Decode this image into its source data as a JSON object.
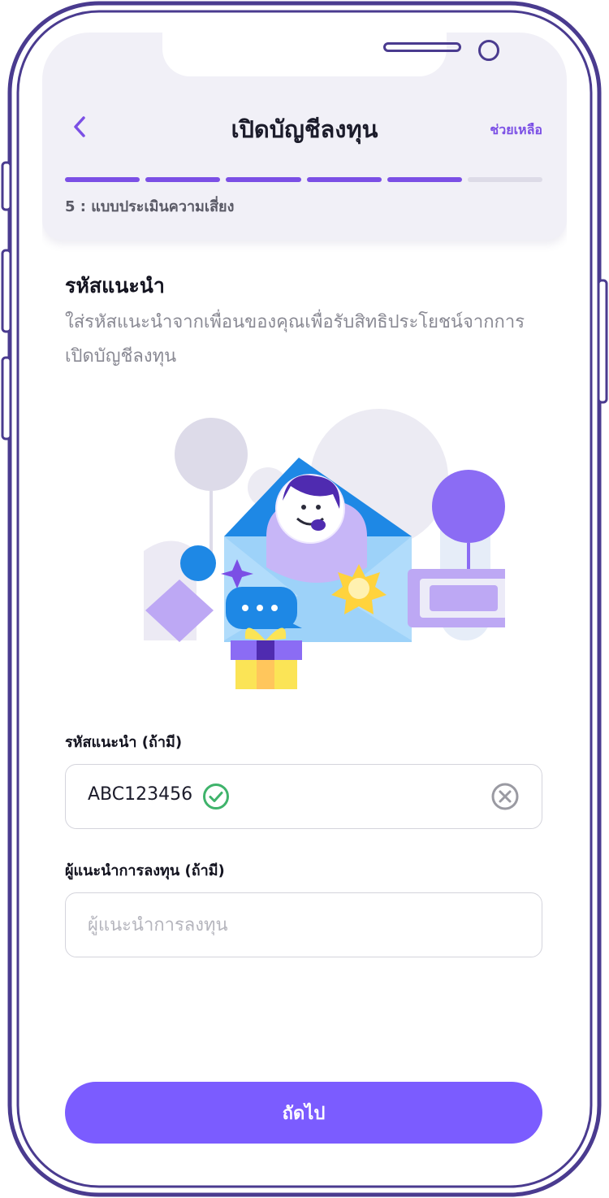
{
  "header": {
    "title": "เปิดบัญชีลงทุน",
    "help_label": "ช่วยเหลือ",
    "progress_total_steps": 6,
    "progress_completed_steps": 5,
    "step_label": "5 : แบบประเมินความเสี่ยง"
  },
  "section": {
    "title": "รหัสแนะนำ",
    "description": "ใส่รหัสแนะนำจากเพื่อนของคุณเพื่อรับสิทธิประโยชน์จากการเปิดบัญชีลงทุน"
  },
  "referral_field": {
    "label": "รหัสแนะนำ (ถ้ามี)",
    "value": "ABC123456",
    "status": "valid"
  },
  "advisor_field": {
    "label": "ผู้แนะนำการลงทุน (ถ้ามี)",
    "value": "",
    "placeholder": "ผู้แนะนำการลงทุน"
  },
  "next_button_label": "ถัดไป",
  "colors": {
    "accent": "#7b4fe5",
    "button": "#7b5cff",
    "frame": "#4a3b8f",
    "success": "#3fb36b"
  }
}
